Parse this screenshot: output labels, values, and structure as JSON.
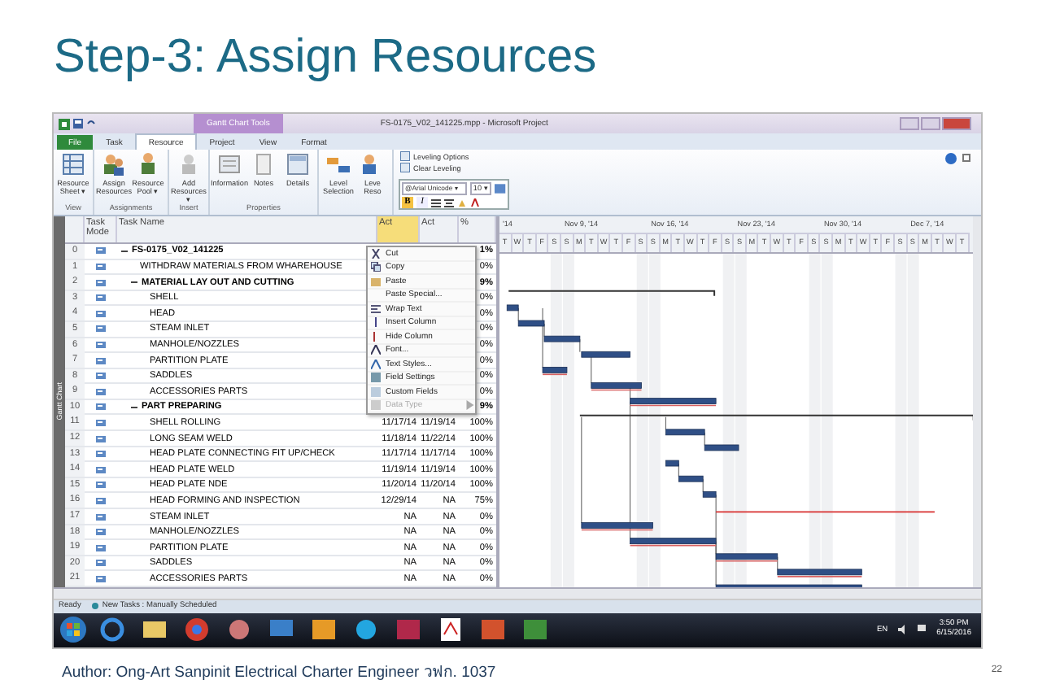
{
  "slide": {
    "title": "Step-3: Assign Resources",
    "footer": "Author: Ong-Art Sanpinit Electrical Charter Engineer วฟก. 1037",
    "page_number": "22"
  },
  "window": {
    "title": "FS-0175_V02_141225.mpp - Microsoft Project",
    "context_tab": "Gantt Chart Tools"
  },
  "ribbon_tabs": [
    {
      "label": "File",
      "selected": false
    },
    {
      "label": "Task",
      "selected": false
    },
    {
      "label": "Resource",
      "selected": true
    },
    {
      "label": "Project",
      "selected": false
    },
    {
      "label": "View",
      "selected": false
    },
    {
      "label": "Format",
      "selected": false
    }
  ],
  "ribbon_groups": [
    {
      "label": "View",
      "buttons": [
        "Resource Sheet ▾"
      ]
    },
    {
      "label": "Assignments",
      "buttons": [
        "Assign Resources",
        "Resource Pool ▾"
      ]
    },
    {
      "label": "Insert",
      "buttons": [
        "Add Resources ▾"
      ]
    },
    {
      "label": "Properties",
      "buttons": [
        "Information",
        "Notes",
        "Details"
      ]
    },
    {
      "buttons": [
        "Level Selection",
        "Leve Reso"
      ]
    }
  ],
  "leveling": [
    "Leveling Options",
    "Clear Leveling"
  ],
  "mini_toolbar": {
    "font": "@Arial Unicode ▾",
    "size": "10 ▾",
    "buttons": [
      {
        "label": "B",
        "selected": true
      },
      {
        "label": "I",
        "selected": false
      }
    ]
  },
  "context_menu": {
    "items": [
      {
        "label": "Cut",
        "disabled": false
      },
      {
        "label": "Copy",
        "disabled": false
      },
      {
        "label": "Paste",
        "disabled": false
      },
      {
        "label": "Paste Special...",
        "disabled": false
      },
      {
        "label": "Wrap Text",
        "disabled": false
      },
      {
        "label": "Insert Column",
        "disabled": false
      },
      {
        "label": "Hide Column",
        "disabled": false
      },
      {
        "label": "Font...",
        "disabled": false
      },
      {
        "label": "Text Styles...",
        "disabled": false
      },
      {
        "label": "Field Settings",
        "disabled": false
      },
      {
        "label": "Custom Fields",
        "disabled": false
      },
      {
        "label": "Data Type",
        "disabled": true
      }
    ]
  },
  "side_label": "Gantt Chart",
  "table": {
    "columns": [
      "Task Mode",
      "Task Name",
      "Act",
      "Act",
      "%"
    ],
    "rows": [
      {
        "id": "0",
        "name": "FS-0175_V02_141225",
        "pct": "1%",
        "expanded": true,
        "children": [
          {
            "id": "1",
            "name": "WITHDRAW MATERIALS FROM WHAREHOUSE",
            "pct": "0%"
          },
          {
            "id": "2",
            "name": "MATERIAL LAY OUT AND CUTTING",
            "pct": "9%",
            "expanded": true,
            "children": [
              {
                "id": "3",
                "name": "SHELL",
                "pct": "0%"
              },
              {
                "id": "4",
                "name": "HEAD",
                "pct": "0%"
              },
              {
                "id": "5",
                "name": "STEAM INLET",
                "pct": "0%"
              },
              {
                "id": "6",
                "name": "MANHOLE/NOZZLES",
                "pct": "0%"
              },
              {
                "id": "7",
                "name": "PARTITION PLATE",
                "pct": "0%"
              },
              {
                "id": "8",
                "name": "SADDLES",
                "pct": "0%"
              },
              {
                "id": "9",
                "name": "ACCESSORIES PARTS",
                "pct": "0%"
              }
            ]
          },
          {
            "id": "10",
            "name": "PART PREPARING",
            "pct": "9%",
            "expanded": true,
            "children": [
              {
                "id": "11",
                "name": "SHELL ROLLING",
                "start": "11/17/14",
                "finish": "11/19/14",
                "pct": "100%"
              },
              {
                "id": "12",
                "name": "LONG SEAM WELD",
                "start": "11/18/14",
                "finish": "11/22/14",
                "pct": "100%"
              },
              {
                "id": "13",
                "name": "HEAD PLATE CONNECTING FIT UP/CHECK",
                "start": "11/17/14",
                "finish": "11/17/14",
                "pct": "100%"
              },
              {
                "id": "14",
                "name": "HEAD PLATE WELD",
                "start": "11/19/14",
                "finish": "11/19/14",
                "pct": "100%"
              },
              {
                "id": "15",
                "name": "HEAD PLATE NDE",
                "start": "11/20/14",
                "finish": "11/20/14",
                "pct": "100%"
              },
              {
                "id": "16",
                "name": "HEAD FORMING AND INSPECTION",
                "start": "12/29/14",
                "finish": "NA",
                "pct": "75%"
              },
              {
                "id": "17",
                "name": "STEAM INLET",
                "start": "NA",
                "finish": "NA",
                "pct": "0%"
              },
              {
                "id": "18",
                "name": "MANHOLE/NOZZLES",
                "start": "NA",
                "finish": "NA",
                "pct": "0%"
              },
              {
                "id": "19",
                "name": "PARTITION PLATE",
                "start": "NA",
                "finish": "NA",
                "pct": "0%"
              },
              {
                "id": "20",
                "name": "SADDLES",
                "start": "NA",
                "finish": "NA",
                "pct": "0%"
              },
              {
                "id": "21",
                "name": "ACCESSORIES PARTS",
                "start": "NA",
                "finish": "NA",
                "pct": "0%"
              }
            ]
          }
        ]
      }
    ]
  },
  "timescale": [
    {
      "label": "'14",
      "days": [
        "T",
        "W",
        "T",
        "F",
        "S"
      ]
    },
    {
      "label": "Nov 9, '14",
      "days": [
        "S",
        "M",
        "T",
        "W",
        "T",
        "F",
        "S"
      ]
    },
    {
      "label": "Nov 16, '14",
      "days": [
        "S",
        "M",
        "T",
        "W",
        "T",
        "F",
        "S"
      ]
    },
    {
      "label": "Nov 23, '14",
      "days": [
        "S",
        "M",
        "T",
        "W",
        "T",
        "F",
        "S"
      ]
    },
    {
      "label": "Nov 30, '14",
      "days": [
        "S",
        "M",
        "T",
        "W",
        "T",
        "F",
        "S"
      ]
    },
    {
      "label": "Dec 7, '14",
      "days": [
        "S",
        "M",
        "T",
        "W",
        "T"
      ]
    }
  ],
  "status_bar": {
    "state": "Ready",
    "mode": "New Tasks : Manually Scheduled"
  },
  "taskbar": {
    "language": "EN",
    "time": "3:50 PM",
    "date": "6/15/2016"
  }
}
